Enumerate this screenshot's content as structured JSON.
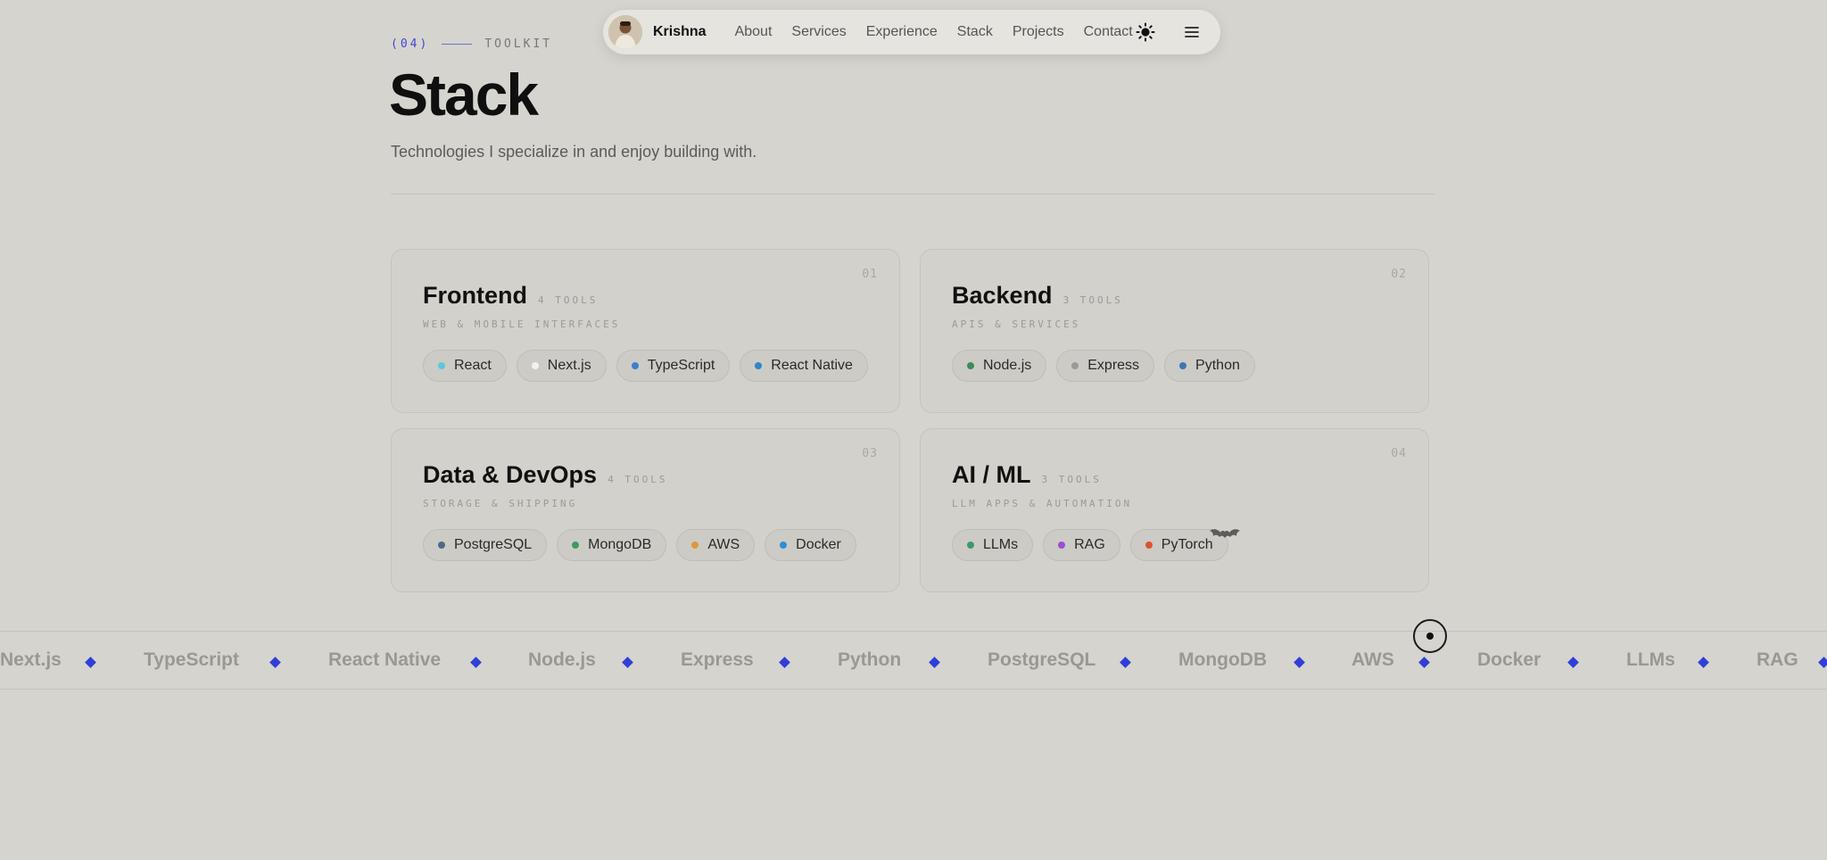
{
  "nav": {
    "brand": "Krishna",
    "links": [
      "About",
      "Services",
      "Experience",
      "Stack",
      "Projects",
      "Contact"
    ],
    "theme_icon": "sun-icon",
    "menu_icon": "hamburger-menu-icon"
  },
  "section": {
    "number": "(04)",
    "eyebrow": "TOOLKIT",
    "title": "Stack",
    "subtitle": "Technologies I specialize in and enjoy building with."
  },
  "cards": [
    {
      "index": "01",
      "title": "Frontend",
      "count": "4 TOOLS",
      "desc": "WEB & MOBILE INTERFACES",
      "tools": [
        {
          "name": "React",
          "color": "#5fc6db"
        },
        {
          "name": "Next.js",
          "color": "#f2f2f2"
        },
        {
          "name": "TypeScript",
          "color": "#3b7fce"
        },
        {
          "name": "React Native",
          "color": "#2f86c9"
        }
      ]
    },
    {
      "index": "02",
      "title": "Backend",
      "count": "3 TOOLS",
      "desc": "APIS & SERVICES",
      "tools": [
        {
          "name": "Node.js",
          "color": "#3f8a5c"
        },
        {
          "name": "Express",
          "color": "#9a9a9a"
        },
        {
          "name": "Python",
          "color": "#3e77b0"
        }
      ]
    },
    {
      "index": "03",
      "title": "Data & DevOps",
      "count": "4 TOOLS",
      "desc": "STORAGE & SHIPPING",
      "tools": [
        {
          "name": "PostgreSQL",
          "color": "#4a6a8a"
        },
        {
          "name": "MongoDB",
          "color": "#3f9a5f"
        },
        {
          "name": "AWS",
          "color": "#d99a3a"
        },
        {
          "name": "Docker",
          "color": "#2f8ed6"
        }
      ]
    },
    {
      "index": "04",
      "title": "AI / ML",
      "count": "3 TOOLS",
      "desc": "LLM APPS & AUTOMATION",
      "tools": [
        {
          "name": "LLMs",
          "color": "#3f9a6a"
        },
        {
          "name": "RAG",
          "color": "#9a4fd6"
        },
        {
          "name": "PyTorch",
          "color": "#e0512f"
        }
      ]
    }
  ],
  "marquee": [
    "Next.js",
    "TypeScript",
    "React Native",
    "Node.js",
    "Express",
    "Python",
    "PostgreSQL",
    "MongoDB",
    "AWS",
    "Docker",
    "LLMs",
    "RAG"
  ],
  "colors": {
    "accent": "#3f46d6",
    "background": "#d6d4ce"
  }
}
